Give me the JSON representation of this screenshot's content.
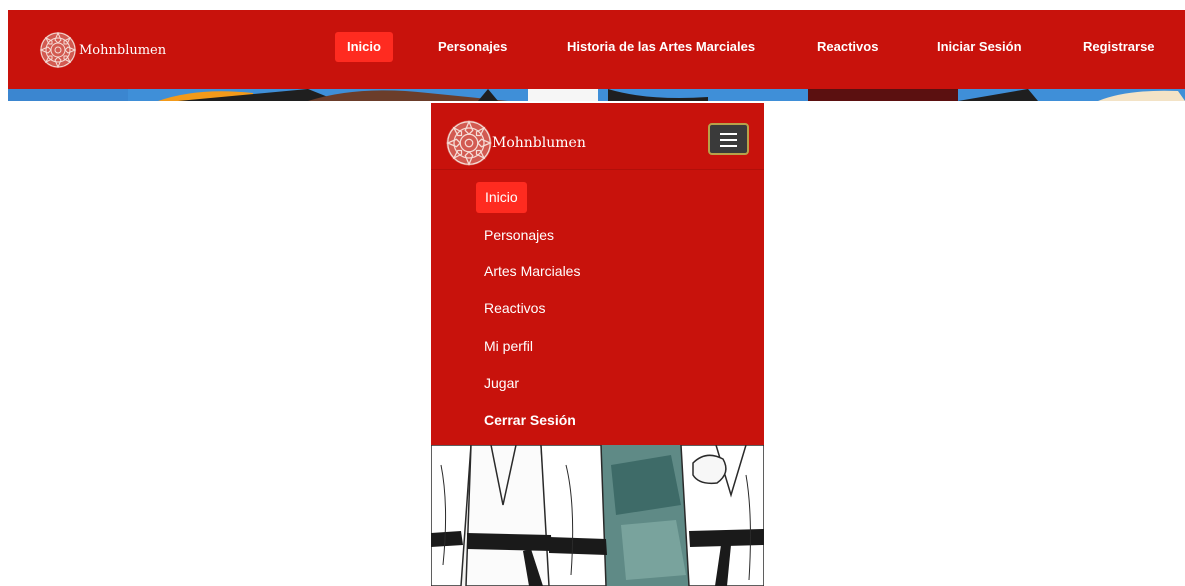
{
  "caption": "",
  "brand": {
    "name": "Mohnblumen",
    "logo": "mandala-logo"
  },
  "desktop_nav": {
    "links": [
      {
        "label": "Inicio",
        "active": true
      },
      {
        "label": "Personajes"
      },
      {
        "label": "Historia de las Artes Marciales"
      },
      {
        "label": "Reactivos"
      },
      {
        "label": "Iniciar Sesión"
      },
      {
        "label": "Registrarse"
      }
    ]
  },
  "mobile_nav": {
    "toggler_icon": "hamburger-icon",
    "links": [
      {
        "label": "Inicio",
        "active": true
      },
      {
        "label": "Personajes"
      },
      {
        "label": "Artes Marciales"
      },
      {
        "label": "Reactivos"
      },
      {
        "label": "Mi perfil"
      },
      {
        "label": "Jugar"
      },
      {
        "label": "Cerrar Sesión",
        "bold": true
      }
    ]
  },
  "colors": {
    "navbar_red": "#c8120c",
    "active_red": "#ff2b20",
    "text_white": "#ffffff"
  }
}
